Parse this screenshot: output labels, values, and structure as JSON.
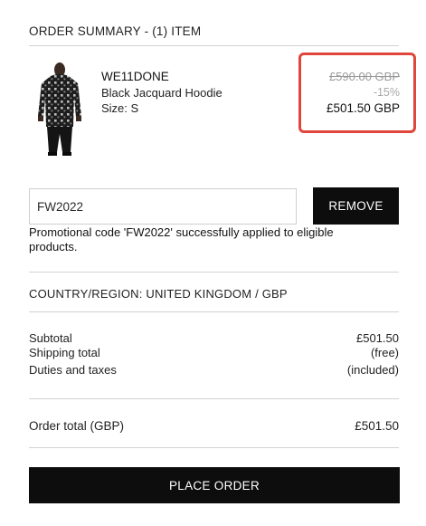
{
  "summary": {
    "title": "ORDER SUMMARY - (1) ITEM"
  },
  "item": {
    "brand": "WE11DONE",
    "name": "Black Jacquard Hoodie",
    "size": "Size: S",
    "price_original": "£590.00 GBP",
    "discount": "-15%",
    "price_final": "£501.50 GBP"
  },
  "colors": {
    "highlight_border": "#e0463b",
    "button_bg": "#0d0d0d",
    "hoodie_dark": "#1d1d1d",
    "hoodie_light": "#bdbdbd"
  },
  "promo": {
    "code_value": "FW2022",
    "remove_label": "REMOVE",
    "message": "Promotional code 'FW2022' successfully applied to eligible products."
  },
  "country": {
    "label": "COUNTRY/REGION: UNITED KINGDOM / GBP"
  },
  "totals": {
    "subtotal_label": "Subtotal",
    "subtotal_value": "£501.50",
    "shipping_label": "Shipping total",
    "shipping_value": "(free)",
    "duties_label": "Duties and taxes",
    "duties_value": "(included)",
    "order_total_label": "Order total (GBP)",
    "order_total_value": "£501.50"
  },
  "actions": {
    "place_order_label": "PLACE ORDER"
  }
}
